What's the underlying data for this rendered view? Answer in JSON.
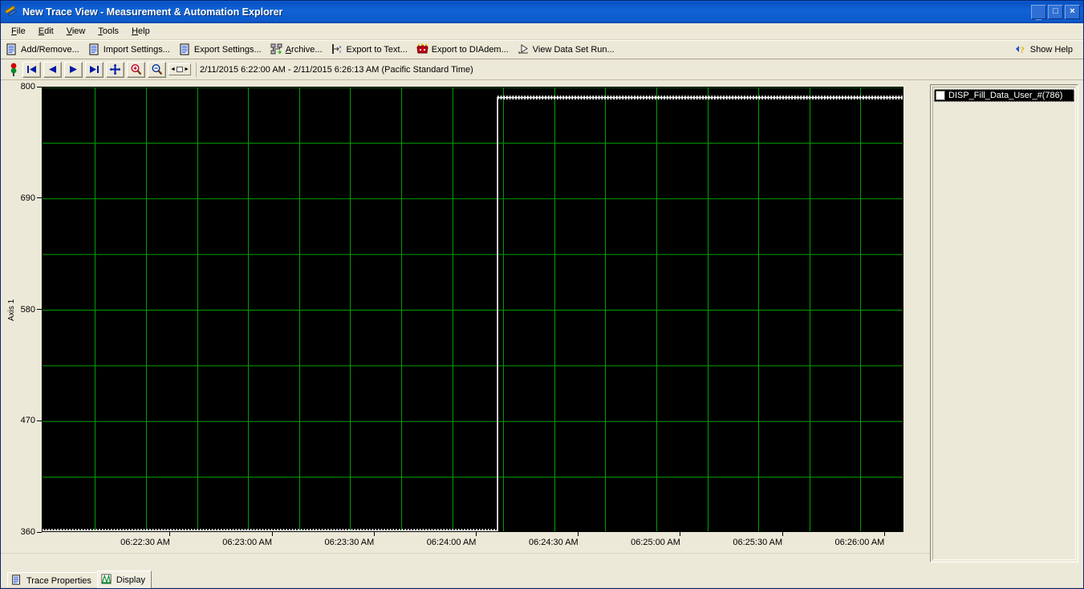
{
  "window": {
    "title": "New Trace View - Measurement & Automation Explorer",
    "icon": "trace-view-icon",
    "minimize_label": "_",
    "maximize_label": "□",
    "close_label": "×"
  },
  "menubar": {
    "items": [
      {
        "label": "File",
        "mnemonic": "F"
      },
      {
        "label": "Edit",
        "mnemonic": "E"
      },
      {
        "label": "View",
        "mnemonic": "V"
      },
      {
        "label": "Tools",
        "mnemonic": "T"
      },
      {
        "label": "Help",
        "mnemonic": "H"
      }
    ]
  },
  "toolbar": {
    "buttons": [
      {
        "label": "Add/Remove...",
        "icon": "document-icon"
      },
      {
        "label": "Import Settings...",
        "icon": "document-icon"
      },
      {
        "label": "Export Settings...",
        "icon": "document-icon"
      },
      {
        "label": "Archive...",
        "icon": "archive-icon"
      },
      {
        "label": "Export to Text...",
        "icon": "export-text-icon"
      },
      {
        "label": "Export to DIAdem...",
        "icon": "diadem-icon"
      },
      {
        "label": "View Data Set Run...",
        "icon": "run-icon"
      }
    ],
    "help_button": {
      "label": "Show Help",
      "icon": "help-arrow-icon"
    }
  },
  "navbar": {
    "status_icon": "traffic-light-icon",
    "buttons": [
      {
        "name": "go-first",
        "icon": "skip-back-icon"
      },
      {
        "name": "go-previous",
        "icon": "play-back-icon"
      },
      {
        "name": "go-next",
        "icon": "play-forward-icon"
      },
      {
        "name": "go-last",
        "icon": "skip-forward-icon"
      },
      {
        "name": "pan",
        "icon": "pan-move-icon"
      },
      {
        "name": "zoom-in",
        "icon": "zoom-in-icon"
      },
      {
        "name": "zoom-out",
        "icon": "zoom-out-icon"
      }
    ],
    "range_widget": {
      "left_arrow": "◄",
      "right_arrow": "►"
    },
    "date_range": "2/11/2015 6:22:00 AM - 2/11/2015 6:26:13 AM (Pacific Standard Time)"
  },
  "legend": {
    "items": [
      {
        "label": "DISP_Fill_Data_User_#(786)",
        "checked": false,
        "selected": true
      }
    ]
  },
  "tabs": [
    {
      "label": "Trace Properties",
      "icon": "document-icon",
      "active": false
    },
    {
      "label": "Display",
      "icon": "display-chart-icon",
      "active": true
    }
  ],
  "colors": {
    "plot_background": "#000000",
    "grid_major": "#00a000",
    "grid_minor": "#006000",
    "trace": "#ffffff",
    "title_bar": "#0a52c4",
    "window_face": "#ece9d8"
  },
  "chart_data": {
    "type": "line",
    "title": "",
    "xlabel": "",
    "ylabel": "Axis 1",
    "ylim": [
      360,
      800
    ],
    "y_ticks": [
      800,
      690,
      580,
      470,
      360
    ],
    "y_minor_count": 1,
    "grid": true,
    "legend_position": "right",
    "x_start": "06:22:00 AM",
    "x_end": "06:26:13 AM",
    "x_ticks": [
      "06:22:30 AM",
      "06:23:00 AM",
      "06:23:30 AM",
      "06:24:00 AM",
      "06:24:30 AM",
      "06:25:00 AM",
      "06:25:30 AM",
      "06:26:00 AM"
    ],
    "x_tick_positions": [
      0.1201,
      0.2385,
      0.357,
      0.4754,
      0.5939,
      0.7123,
      0.8308,
      0.9492
    ],
    "series": [
      {
        "name": "DISP_Fill_Data_User_#(786)",
        "color": "#ffffff",
        "marker": "dotted",
        "description": "Step trace: low level near 362 from 06:22:00 until 06:24:12, then a vertical rise to the high level near 790 held until 06:26:13",
        "points": [
          {
            "x": 0.0,
            "y": 362
          },
          {
            "x": 0.528,
            "y": 362
          },
          {
            "x": 0.528,
            "y": 790
          },
          {
            "x": 1.0,
            "y": 790
          }
        ],
        "step_x_fraction": 0.528,
        "low_value": 362,
        "high_value": 790
      }
    ]
  }
}
